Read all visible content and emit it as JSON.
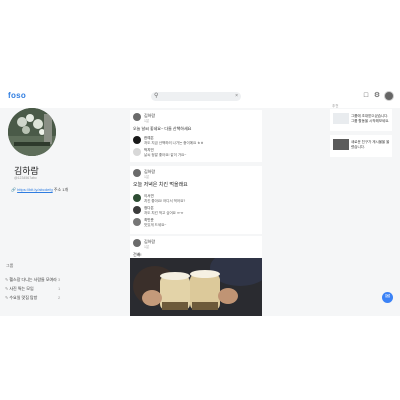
{
  "header": {
    "logo": "foso",
    "search_icon": "search-icon",
    "clear_icon": "close-icon",
    "notification_icon": "bell-icon",
    "settings_icon": "gear-icon"
  },
  "profile": {
    "name": "김하람",
    "subtitle": "@1234567abc",
    "link_icon": "link-icon",
    "link_text": "https://bit.ly/abcdefg",
    "link_suffix": "주소 1개"
  },
  "groups": {
    "title": "그룹",
    "items": [
      {
        "icon": "pencil-icon",
        "label": "헬스장 다니는 사람들 모여라",
        "count": "3"
      },
      {
        "icon": "pencil-icon",
        "label": "사진 찍는 모임",
        "count": "1"
      },
      {
        "icon": "pencil-icon",
        "label": "수요일 맛집 탐방",
        "count": "2"
      }
    ]
  },
  "posts": [
    {
      "author": "김하람",
      "time": "1분",
      "content": "오늘 날씨 좋네요~ 다들 산책하세요",
      "comments": [
        {
          "author": "한예은",
          "text": "저도 지금 산책하러 나가는 중이에요 ㅎㅎ"
        },
        {
          "author": "박지민",
          "text": "날씨 정말 좋아요! 같이 가요~"
        }
      ]
    },
    {
      "author": "김하람",
      "time": "1분",
      "content": "오늘 저녁은 치킨 먹을래요",
      "comments": [
        {
          "author": "이서연",
          "text": "치킨 좋아요! 어디서 먹어요?"
        },
        {
          "author": "정다은",
          "text": "저도 치킨 먹고 싶어요 ㅠㅠ"
        },
        {
          "author": "최민준",
          "text": "맛있게 드세요~"
        }
      ]
    },
    {
      "author": "김하람",
      "time": "1분",
      "content": "건배!",
      "comments": []
    }
  ],
  "side": {
    "label": "추천",
    "cards": [
      {
        "text": "그룹에 초대받으셨습니다. 그룹 활동을 시작해보세요."
      },
      {
        "text": "새로운 친구가 게시물을 올렸습니다."
      }
    ]
  },
  "fab_icon": "chat-icon",
  "colors": {
    "accent": "#2f7de1",
    "background": "#f5f6f7",
    "card": "#ffffff",
    "fab": "#3b82f6"
  }
}
